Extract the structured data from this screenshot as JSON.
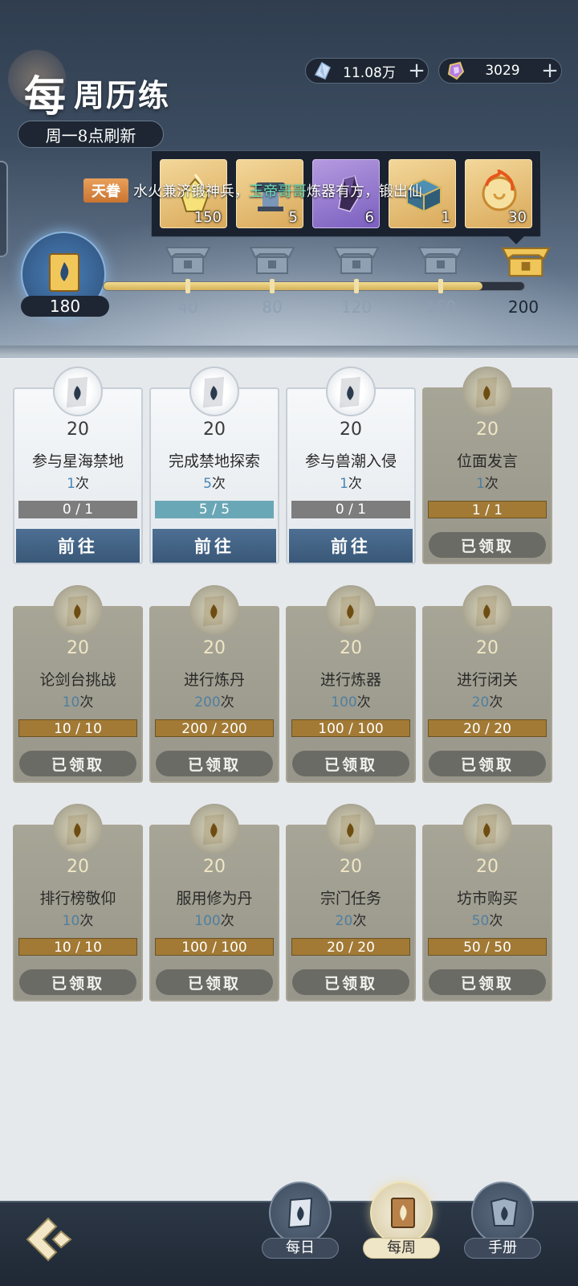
{
  "header": {
    "title_main": "每",
    "title_sub": "周历练",
    "refresh_text": "周一8点刷新"
  },
  "currencies": [
    {
      "icon": "crystal-icon",
      "value": "11.08万"
    },
    {
      "icon": "spirit-stone-icon",
      "value": "3029"
    }
  ],
  "broadcast": {
    "tag": "天眷",
    "text_before": "水火兼济锻神兵，",
    "highlight": "玉帝哥哥",
    "text_after": "炼器有方，锻出仙"
  },
  "reward_popup": {
    "items": [
      {
        "icon": "golden-ore-icon",
        "qty": "150",
        "rarity": "gold"
      },
      {
        "icon": "forge-anvil-icon",
        "qty": "5",
        "rarity": "gold"
      },
      {
        "icon": "purple-crystal-icon",
        "qty": "6",
        "rarity": "purple"
      },
      {
        "icon": "treasure-box-icon",
        "qty": "1",
        "rarity": "gold"
      },
      {
        "icon": "flame-orb-icon",
        "qty": "30",
        "rarity": "gold"
      }
    ]
  },
  "progress": {
    "current": "180",
    "current_value": 180,
    "max_value": 200,
    "milestones": [
      "40",
      "80",
      "120",
      "160",
      "200"
    ]
  },
  "tasks": [
    {
      "points": "20",
      "name": "参与星海禁地",
      "times": "1",
      "times_suffix": "次",
      "progress": "0 / 1",
      "status": "go",
      "button": "前往"
    },
    {
      "points": "20",
      "name": "完成禁地探索",
      "times": "5",
      "times_suffix": "次",
      "progress": "5 / 5",
      "status": "go-full",
      "button": "前往"
    },
    {
      "points": "20",
      "name": "参与兽潮入侵",
      "times": "1",
      "times_suffix": "次",
      "progress": "0 / 1",
      "status": "go",
      "button": "前往"
    },
    {
      "points": "20",
      "name": "位面发言",
      "times": "1",
      "times_suffix": "次",
      "progress": "1 / 1",
      "status": "claimed",
      "button": "已领取"
    },
    {
      "points": "20",
      "name": "论剑台挑战",
      "times": "10",
      "times_suffix": "次",
      "progress": "10 / 10",
      "status": "claimed",
      "button": "已领取"
    },
    {
      "points": "20",
      "name": "进行炼丹",
      "times": "200",
      "times_suffix": "次",
      "progress": "200 / 200",
      "status": "claimed",
      "button": "已领取"
    },
    {
      "points": "20",
      "name": "进行炼器",
      "times": "100",
      "times_suffix": "次",
      "progress": "100 / 100",
      "status": "claimed",
      "button": "已领取"
    },
    {
      "points": "20",
      "name": "进行闭关",
      "times": "20",
      "times_suffix": "次",
      "progress": "20 / 20",
      "status": "claimed",
      "button": "已领取"
    },
    {
      "points": "20",
      "name": "排行榜敬仰",
      "times": "10",
      "times_suffix": "次",
      "progress": "10 / 10",
      "status": "claimed",
      "button": "已领取"
    },
    {
      "points": "20",
      "name": "服用修为丹",
      "times": "100",
      "times_suffix": "次",
      "progress": "100 / 100",
      "status": "claimed",
      "button": "已领取"
    },
    {
      "points": "20",
      "name": "宗门任务",
      "times": "20",
      "times_suffix": "次",
      "progress": "20 / 20",
      "status": "claimed",
      "button": "已领取"
    },
    {
      "points": "20",
      "name": "坊市购买",
      "times": "50",
      "times_suffix": "次",
      "progress": "50 / 50",
      "status": "claimed",
      "button": "已领取"
    }
  ],
  "bottom_nav": {
    "tabs": [
      {
        "label": "每日",
        "icon": "daily-scroll-icon",
        "active": false
      },
      {
        "label": "每周",
        "icon": "weekly-book-icon",
        "active": true
      },
      {
        "label": "手册",
        "icon": "handbook-icon",
        "active": false
      }
    ]
  },
  "colors": {
    "accent_gold": "#d3b15a",
    "button_blue": "#4d6f93",
    "claimed_card": "#a7a596",
    "header_dark": "#2f3d4f"
  }
}
